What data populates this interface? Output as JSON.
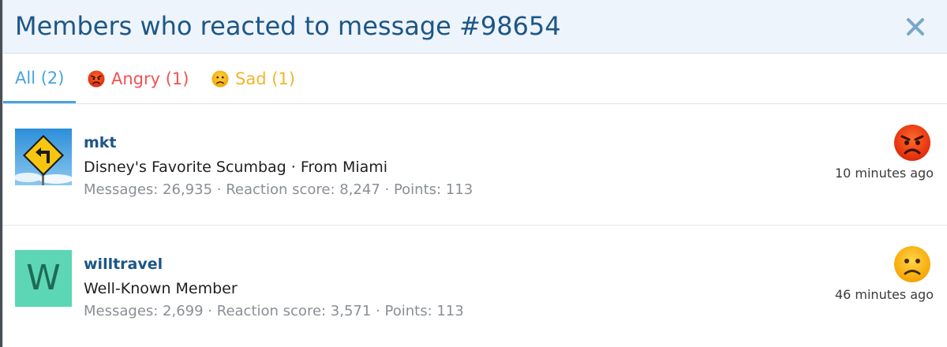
{
  "modal": {
    "title": "Members who reacted to message #98654",
    "close_icon": "close-icon"
  },
  "tabs": [
    {
      "label": "All (2)",
      "color": "#47a3e0",
      "active": true
    },
    {
      "label": "Angry (1)",
      "icon": "angry-face-icon",
      "color": "#ef5350"
    },
    {
      "label": "Sad (1)",
      "icon": "sad-face-icon",
      "color": "#f0b62a"
    }
  ],
  "members": [
    {
      "username": "mkt",
      "avatar": "road-sign-avatar",
      "user_title": "Disney's Favorite Scumbag · From Miami",
      "stats": "Messages: 26,935 · Reaction score: 8,247 · Points: 113",
      "reaction_icon": "angry-face-icon",
      "time": "10 minutes ago"
    },
    {
      "username": "willtravel",
      "avatar_letter": "W",
      "avatar_color": "#5dd6b5",
      "user_title": "Well-Known Member",
      "stats": "Messages: 2,699 · Reaction score: 3,571 · Points: 113",
      "reaction_icon": "sad-face-icon",
      "time": "46 minutes ago"
    }
  ],
  "colors": {
    "header_bg": "#edf4fb",
    "title": "#1d5686",
    "username": "#1d5686",
    "stats": "#8a8f96"
  }
}
